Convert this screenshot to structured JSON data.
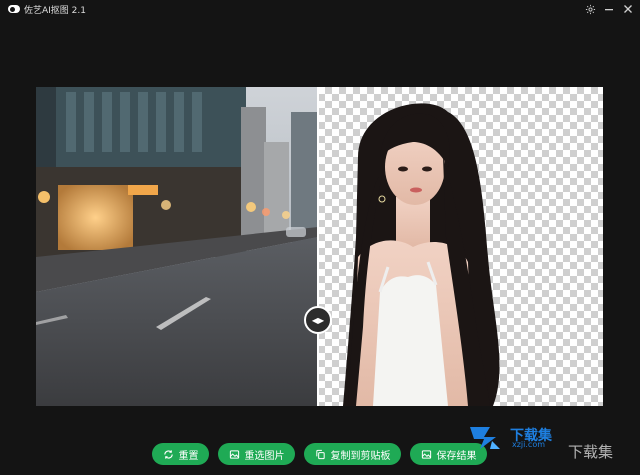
{
  "window": {
    "title": "佐艺AI抠图  2.1",
    "settings_icon": "gear-icon",
    "minimize_icon": "minimize-icon",
    "close_icon": "close-icon"
  },
  "canvas": {
    "divider_position_fraction": 0.497
  },
  "actions": {
    "reset_label": "重置",
    "reselect_label": "重选图片",
    "copy_label": "复制到剪贴板",
    "save_label": "保存结果"
  },
  "watermark": {
    "brand_cn": "下载集",
    "url": "xzji.com",
    "brand_cn_large": "下载集"
  },
  "colors": {
    "background": "#141414",
    "accent_green": "#1faa55",
    "watermark_blue": "#1e7fe0"
  }
}
